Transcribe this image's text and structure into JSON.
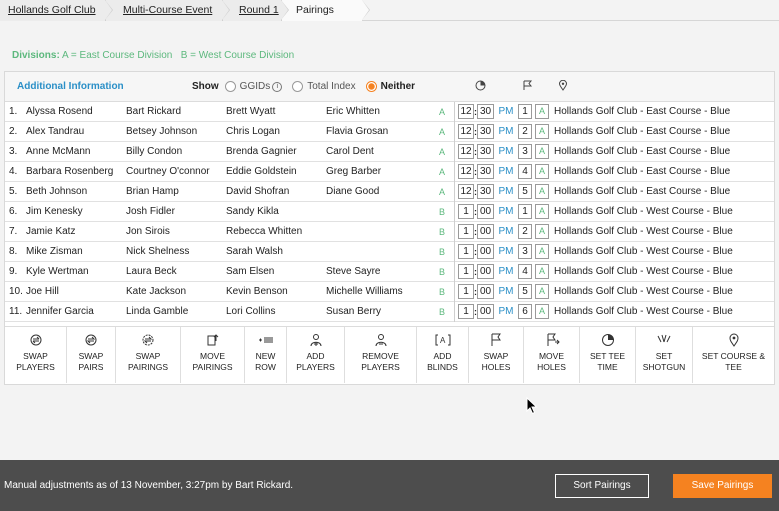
{
  "breadcrumbs": [
    "Hollands Golf Club",
    "Multi-Course Event",
    "Round 1",
    "Pairings"
  ],
  "divisions": {
    "label": "Divisions:",
    "text": "A = East Course Division   B = West Course Division"
  },
  "info": {
    "title": "Additional Information",
    "show_label": "Show",
    "options": [
      "GGIDs",
      "Total Index",
      "Neither"
    ],
    "selected": "Neither"
  },
  "pairings": [
    {
      "num": "1.",
      "players": [
        "Alyssa Rosend",
        "Bart Rickard",
        "Brett Wyatt",
        "Eric Whitten"
      ],
      "div": "A",
      "hh": "12",
      "mm": "30",
      "ampm": "PM",
      "hole": "1",
      "tee": "A",
      "course": "Hollands Golf Club - East Course - Blue"
    },
    {
      "num": "2.",
      "players": [
        "Alex Tandrau",
        "Betsey Johnson",
        "Chris Logan",
        "Flavia Grosan"
      ],
      "div": "A",
      "hh": "12",
      "mm": "30",
      "ampm": "PM",
      "hole": "2",
      "tee": "A",
      "course": "Hollands Golf Club - East Course - Blue"
    },
    {
      "num": "3.",
      "players": [
        "Anne McMann",
        "Billy Condon",
        "Brenda Gagnier",
        "Carol Dent"
      ],
      "div": "A",
      "hh": "12",
      "mm": "30",
      "ampm": "PM",
      "hole": "3",
      "tee": "A",
      "course": "Hollands Golf Club - East Course - Blue"
    },
    {
      "num": "4.",
      "players": [
        "Barbara Rosenberg",
        "Courtney O'connor",
        "Eddie Goldstein",
        "Greg Barber"
      ],
      "div": "A",
      "hh": "12",
      "mm": "30",
      "ampm": "PM",
      "hole": "4",
      "tee": "A",
      "course": "Hollands Golf Club - East Course - Blue"
    },
    {
      "num": "5.",
      "players": [
        "Beth Johnson",
        "Brian Hamp",
        "David Shofran",
        "Diane Good"
      ],
      "div": "A",
      "hh": "12",
      "mm": "30",
      "ampm": "PM",
      "hole": "5",
      "tee": "A",
      "course": "Hollands Golf Club - East Course - Blue"
    },
    {
      "num": "6.",
      "players": [
        "Jim Kenesky",
        "Josh Fidler",
        "Sandy Kikla",
        ""
      ],
      "div": "B",
      "hh": "1",
      "mm": "00",
      "ampm": "PM",
      "hole": "1",
      "tee": "A",
      "course": "Hollands Golf Club - West Course - Blue"
    },
    {
      "num": "7.",
      "players": [
        "Jamie Katz",
        "Jon Sirois",
        "Rebecca Whitten",
        ""
      ],
      "div": "B",
      "hh": "1",
      "mm": "00",
      "ampm": "PM",
      "hole": "2",
      "tee": "A",
      "course": "Hollands Golf Club - West Course - Blue"
    },
    {
      "num": "8.",
      "players": [
        "Mike Zisman",
        "Nick Shelness",
        "Sarah Walsh",
        ""
      ],
      "div": "B",
      "hh": "1",
      "mm": "00",
      "ampm": "PM",
      "hole": "3",
      "tee": "A",
      "course": "Hollands Golf Club - West Course - Blue"
    },
    {
      "num": "9.",
      "players": [
        "Kyle Wertman",
        "Laura Beck",
        "Sam Elsen",
        "Steve Sayre"
      ],
      "div": "B",
      "hh": "1",
      "mm": "00",
      "ampm": "PM",
      "hole": "4",
      "tee": "A",
      "course": "Hollands Golf Club - West Course - Blue"
    },
    {
      "num": "10.",
      "players": [
        "Joe Hill",
        "Kate Jackson",
        "Kevin Benson",
        "Michelle Williams"
      ],
      "div": "B",
      "hh": "1",
      "mm": "00",
      "ampm": "PM",
      "hole": "5",
      "tee": "A",
      "course": "Hollands Golf Club - West Course - Blue"
    },
    {
      "num": "11.",
      "players": [
        "Jennifer Garcia",
        "Linda Gamble",
        "Lori Collins",
        "Susan Berry"
      ],
      "div": "B",
      "hh": "1",
      "mm": "00",
      "ampm": "PM",
      "hole": "6",
      "tee": "A",
      "course": "Hollands Golf Club - West Course - Blue"
    }
  ],
  "tools": [
    {
      "line1": "SWAP",
      "line2": "PLAYERS",
      "icon": "swap-players-icon"
    },
    {
      "line1": "SWAP",
      "line2": "PAIRS",
      "icon": "swap-pairs-icon"
    },
    {
      "line1": "SWAP",
      "line2": "PAIRINGS",
      "icon": "swap-pairings-icon"
    },
    {
      "line1": "MOVE",
      "line2": "PAIRINGS",
      "icon": "move-pairings-icon"
    },
    {
      "line1": "NEW",
      "line2": "ROW",
      "icon": "new-row-icon"
    },
    {
      "line1": "ADD",
      "line2": "PLAYERS",
      "icon": "add-players-icon"
    },
    {
      "line1": "REMOVE",
      "line2": "PLAYERS",
      "icon": "remove-players-icon"
    },
    {
      "line1": "ADD",
      "line2": "BLINDS",
      "icon": "add-blinds-icon"
    },
    {
      "line1": "SWAP",
      "line2": "HOLES",
      "icon": "swap-holes-icon"
    },
    {
      "line1": "MOVE",
      "line2": "HOLES",
      "icon": "move-holes-icon"
    },
    {
      "line1": "SET TEE",
      "line2": "TIME",
      "icon": "set-tee-time-icon"
    },
    {
      "line1": "SET",
      "line2": "SHOTGUN",
      "icon": "set-shotgun-icon"
    },
    {
      "line1": "SET COURSE & TEE",
      "line2": "",
      "icon": "set-course-tee-icon"
    }
  ],
  "footer": {
    "message": "Manual adjustments as of 13 November, 3:27pm by Bart Rickard.",
    "sort_label": "Sort Pairings",
    "save_label": "Save Pairings"
  },
  "colors": {
    "accent_orange": "#f58220",
    "division_green": "#5cb87d",
    "link_blue": "#2a8fc7",
    "footer_bg": "#4d4d4d"
  }
}
